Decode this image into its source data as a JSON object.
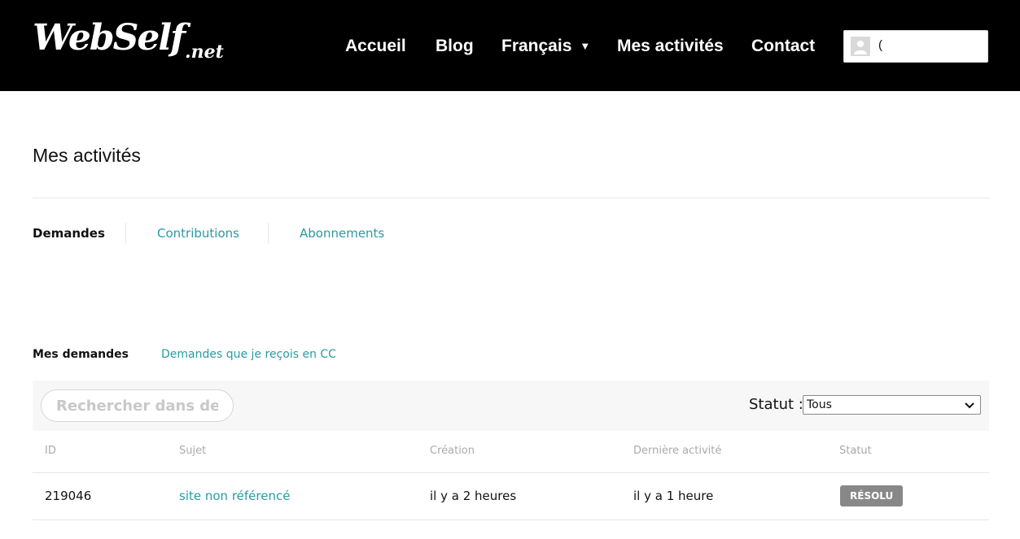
{
  "header": {
    "logo_text": "WebSelf",
    "logo_tld": ".net",
    "nav": [
      {
        "label": "Accueil"
      },
      {
        "label": "Blog"
      },
      {
        "label": "Français"
      },
      {
        "label": "Mes activités"
      },
      {
        "label": "Contact"
      }
    ],
    "user_name": "("
  },
  "page": {
    "title": "Mes activités",
    "tabs": [
      {
        "label": "Demandes",
        "active": true
      },
      {
        "label": "Contributions",
        "active": false
      },
      {
        "label": "Abonnements",
        "active": false
      }
    ],
    "subtabs": [
      {
        "label": "Mes demandes",
        "active": true
      },
      {
        "label": "Demandes que je reçois en CC",
        "active": false
      }
    ]
  },
  "filters": {
    "search_placeholder": "Rechercher dans dema",
    "statut_label": "Statut :",
    "statut_selected": "Tous"
  },
  "table": {
    "columns": [
      "ID",
      "Sujet",
      "Création",
      "Dernière activité",
      "Statut"
    ],
    "rows": [
      {
        "id": "219046",
        "subject": "site non référencé",
        "created": "il y a 2 heures",
        "last_activity": "il y a 1 heure",
        "status": "RÉSOLU"
      }
    ]
  },
  "colors": {
    "header_bg": "#000000",
    "link": "#2a9aa2",
    "badge_bg": "#888888"
  }
}
